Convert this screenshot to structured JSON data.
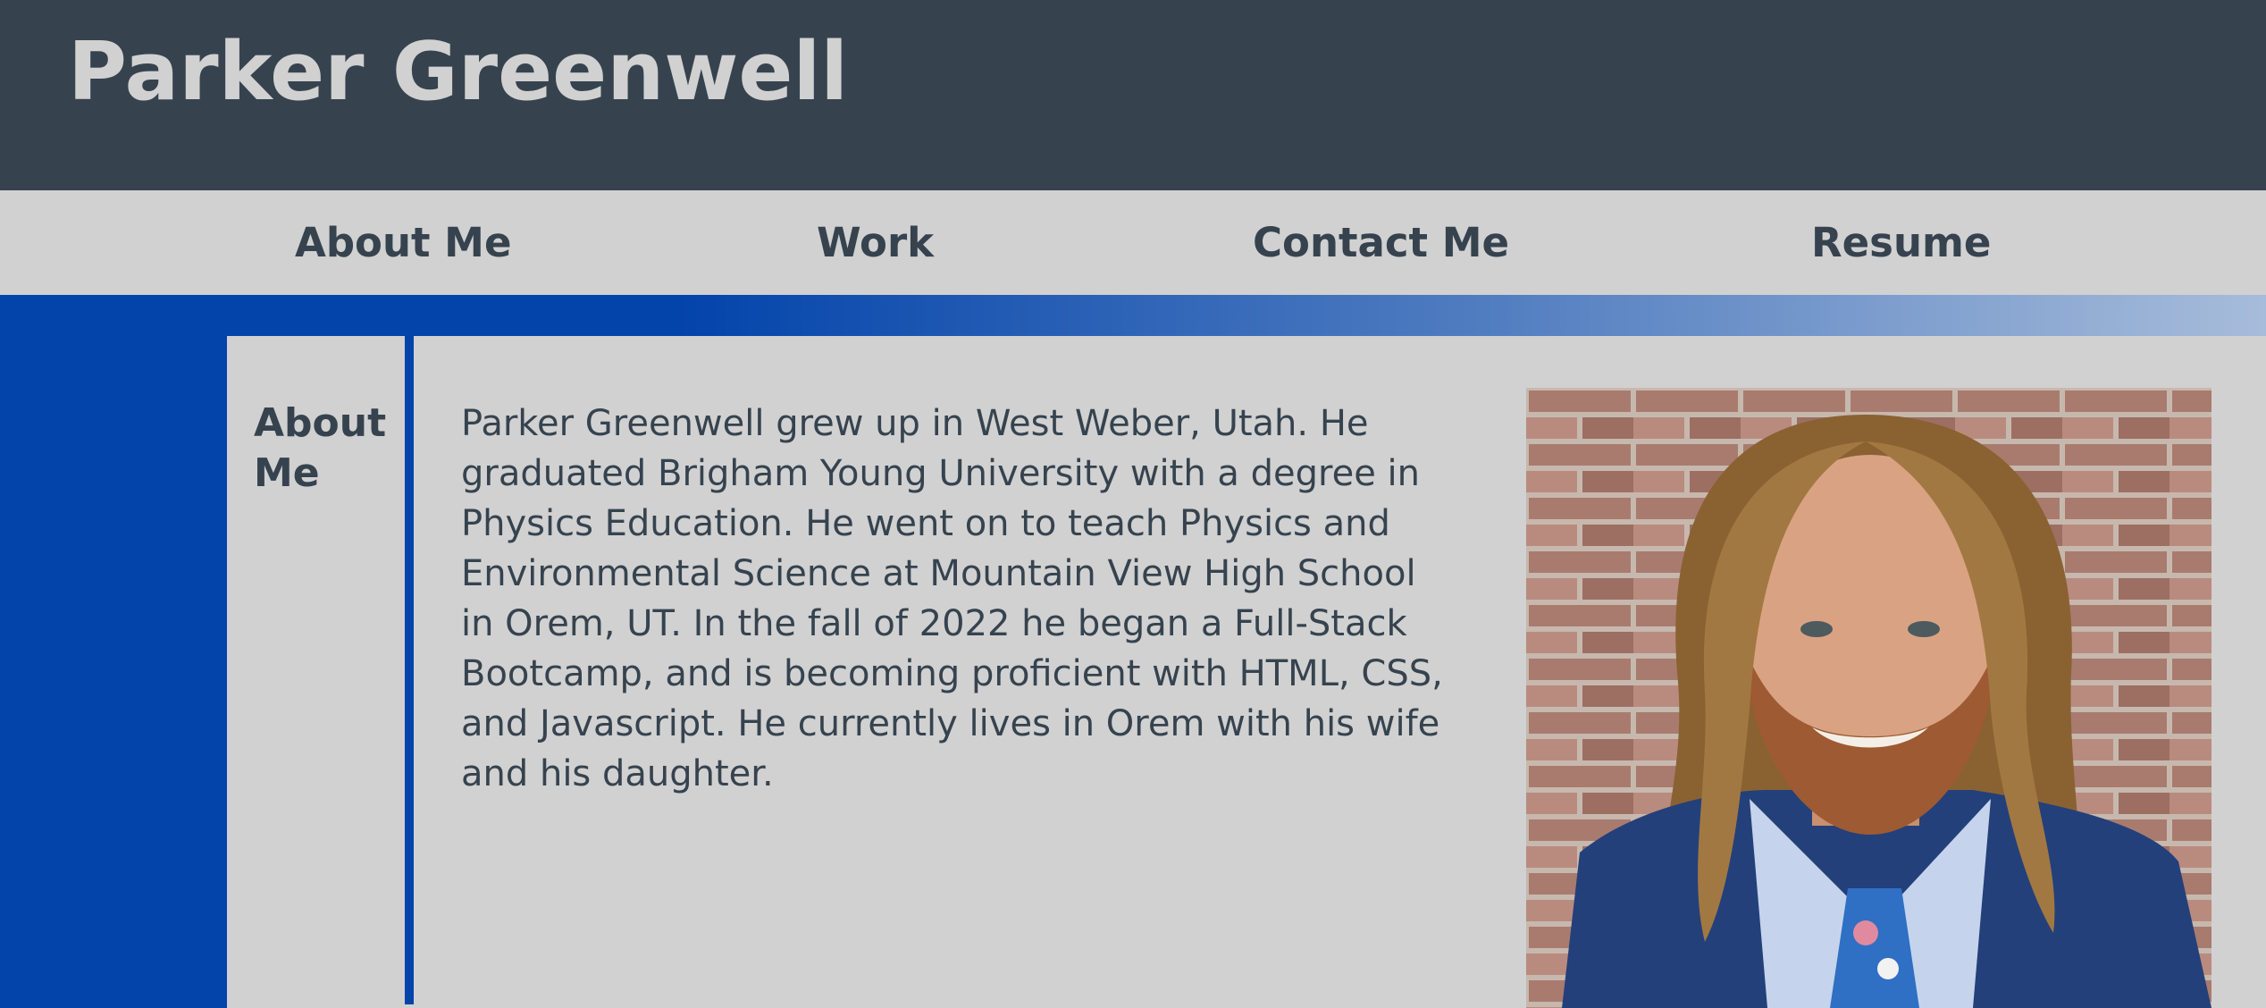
{
  "header": {
    "title": "Parker Greenwell"
  },
  "nav": {
    "items": [
      {
        "label": "About Me"
      },
      {
        "label": "Work"
      },
      {
        "label": "Contact Me"
      },
      {
        "label": "Resume"
      }
    ]
  },
  "about": {
    "heading": "About Me",
    "bio": "Parker Greenwell grew up in West Weber, Utah. He graduated Brigham Young University with a degree in Physics Education. He went on to teach Physics and Environmental Science at Mountain View High School in Orem, UT. In the fall of 2022 he began a Full-Stack Bootcamp, and is becoming proficient with HTML, CSS, and Javascript. He currently lives in Orem with his wife and his daughter."
  },
  "colors": {
    "header_bg": "#36434f",
    "nav_bg": "#d1d1d1",
    "accent_blue": "#0344ab",
    "text_dark": "#36434f",
    "title_text": "#d1d1d1"
  }
}
